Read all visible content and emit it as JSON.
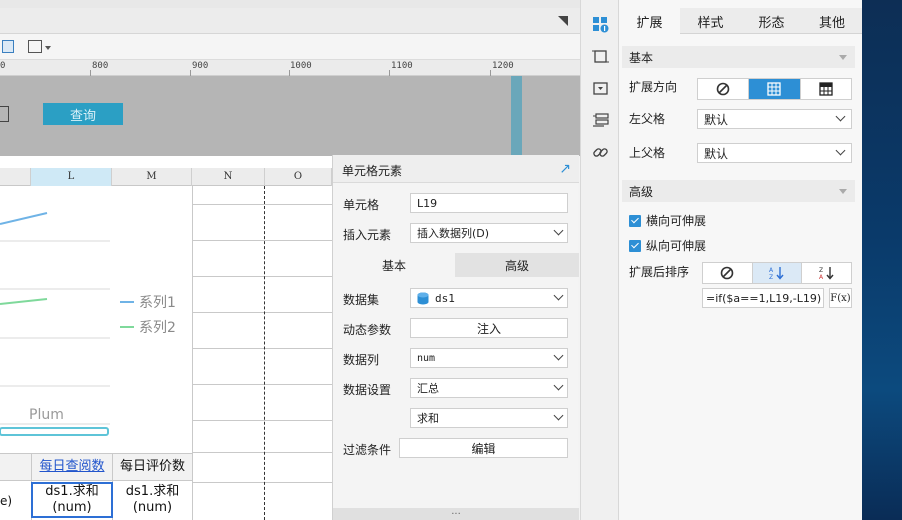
{
  "ruler": {
    "labels": [
      "0",
      "800",
      "900",
      "1000",
      "1100",
      "1200"
    ]
  },
  "param_panel": {
    "query_label": "查询"
  },
  "grid": {
    "columns": [
      {
        "id": "blank",
        "label": ""
      },
      {
        "id": "L",
        "label": "L"
      },
      {
        "id": "M",
        "label": "M"
      },
      {
        "id": "N",
        "label": "N"
      },
      {
        "id": "O",
        "label": "O"
      }
    ],
    "legend": [
      "系列1",
      "系列2"
    ],
    "chart_category": "Plum",
    "header_cells": [
      "每日查阅数",
      "每日评价数"
    ],
    "data_cells": [
      "ds1.求和(num)",
      "ds1.求和(num)"
    ],
    "partial_cell": "e)",
    "colors": {
      "series1": "#6fb3e6",
      "series2": "#7fd99b",
      "selected_col": "#cfe9f6"
    }
  },
  "cell_popup": {
    "title": "单元格元素",
    "cell_label": "单元格",
    "cell_value": "L19",
    "insert_label": "插入元素",
    "insert_value": "插入数据列(D)",
    "tabs": [
      "基本",
      "高级"
    ],
    "dataset_label": "数据集",
    "dataset_value": "ds1",
    "dynamic_param_label": "动态参数",
    "inject_label": "注入",
    "data_column_label": "数据列",
    "data_column_value": "num",
    "data_setting_label": "数据设置",
    "data_setting_value": "汇总",
    "aggregate_value": "求和",
    "filter_label": "过滤条件",
    "edit_label": "编辑",
    "footer": "..."
  },
  "prop_panel": {
    "tabs": [
      "扩展",
      "样式",
      "形态",
      "其他"
    ],
    "active_tab": "扩展",
    "section_basic": "基本",
    "expand_direction_label": "扩展方向",
    "left_parent_label": "左父格",
    "left_parent_value": "默认",
    "top_parent_label": "上父格",
    "top_parent_value": "默认",
    "section_advanced": "高级",
    "horizontal_label": "横向可伸展",
    "vertical_label": "纵向可伸展",
    "sort_label": "扩展后排序",
    "formula": "=if($a==1,L19,-L19)",
    "formula_button": "F(x)"
  },
  "side_icons": [
    "cell-attribute-icon",
    "widget-icon",
    "float-element-icon",
    "condition-icon",
    "hyperlink-icon"
  ]
}
